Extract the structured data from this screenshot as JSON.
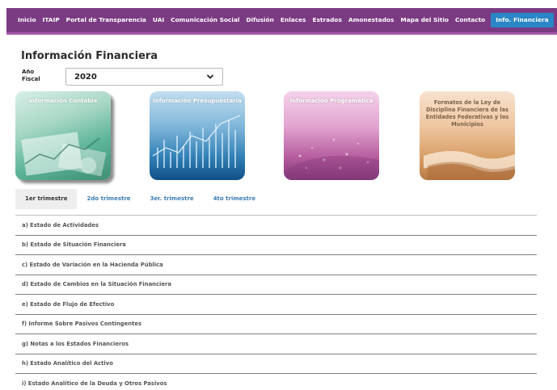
{
  "nav": {
    "items": [
      {
        "label": "Inicio"
      },
      {
        "label": "ITAIP"
      },
      {
        "label": "Portal de Transparencia"
      },
      {
        "label": "UAI"
      },
      {
        "label": "Comunicación Social"
      },
      {
        "label": "Difusión"
      },
      {
        "label": "Enlaces"
      },
      {
        "label": "Estrados"
      },
      {
        "label": "Amonestados"
      },
      {
        "label": "Mapa del Sitio"
      },
      {
        "label": "Contacto"
      },
      {
        "label": "Info. Financiera",
        "active": true
      }
    ]
  },
  "page": {
    "title": "Información Financiera",
    "year_label": "Año Fiscal",
    "year_value": "2020"
  },
  "cards": [
    {
      "label": "Información Contable"
    },
    {
      "label": "Información Presupuestaria"
    },
    {
      "label": "Información Programática"
    },
    {
      "label": "Formatos de la Ley de Disciplina Financiera de las Entidades Federativas y los Municipios"
    }
  ],
  "tabs": [
    {
      "label": "1er trimestre",
      "active": true
    },
    {
      "label": "2do trimestre"
    },
    {
      "label": "3er. trimestre"
    },
    {
      "label": "4to trimestre"
    }
  ],
  "statements": [
    "a) Estado de Actividades",
    "b) Estado de Situación Financiera",
    "c) Estado de Variación en la Hacienda Pública",
    "d) Estado de Cambios en la Situación Financiera",
    "e) Estado de Flujo de Efectivo",
    "f) Informe Sobre Pasivos Contingentes",
    "g) Notas a los Estados Financieros",
    "h) Estado Analítico del Activo",
    "i) Estado Analítico de la Deuda y Otros Pasivos"
  ],
  "colors": {
    "nav_bg": "#7b3b83",
    "nav_active": "#2a87c5",
    "tab_link": "#3b7db5"
  }
}
